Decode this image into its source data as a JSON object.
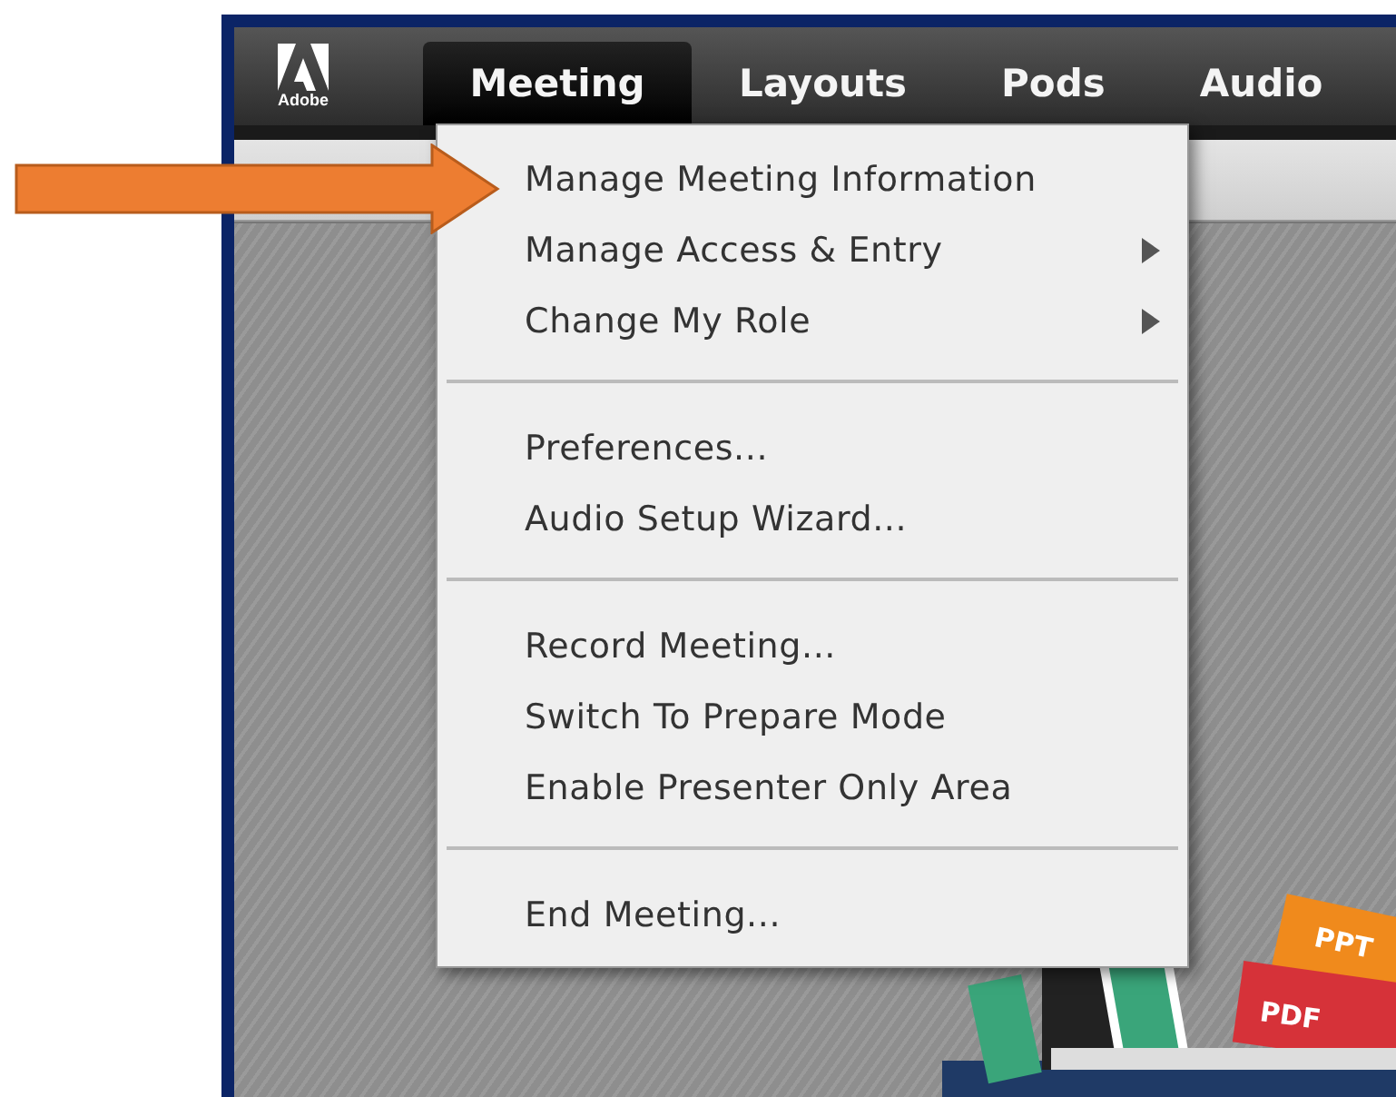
{
  "app": {
    "logo_text": "Adobe",
    "menubar": [
      {
        "label": "Meeting",
        "selected": true
      },
      {
        "label": "Layouts",
        "selected": false
      },
      {
        "label": "Pods",
        "selected": false
      },
      {
        "label": "Audio",
        "selected": false
      }
    ],
    "dropdown": {
      "groups": [
        [
          {
            "label": "Manage Meeting Information",
            "submenu": false
          },
          {
            "label": "Manage Access & Entry",
            "submenu": true
          },
          {
            "label": "Change My Role",
            "submenu": true
          }
        ],
        [
          {
            "label": "Preferences...",
            "submenu": false
          },
          {
            "label": "Audio Setup Wizard...",
            "submenu": false
          }
        ],
        [
          {
            "label": "Record Meeting...",
            "submenu": false
          },
          {
            "label": "Switch To Prepare Mode",
            "submenu": false
          },
          {
            "label": "Enable Presenter Only Area",
            "submenu": false
          }
        ],
        [
          {
            "label": "End Meeting...",
            "submenu": false
          }
        ]
      ]
    },
    "artwork_tags": [
      "PPT",
      "PDF"
    ]
  }
}
